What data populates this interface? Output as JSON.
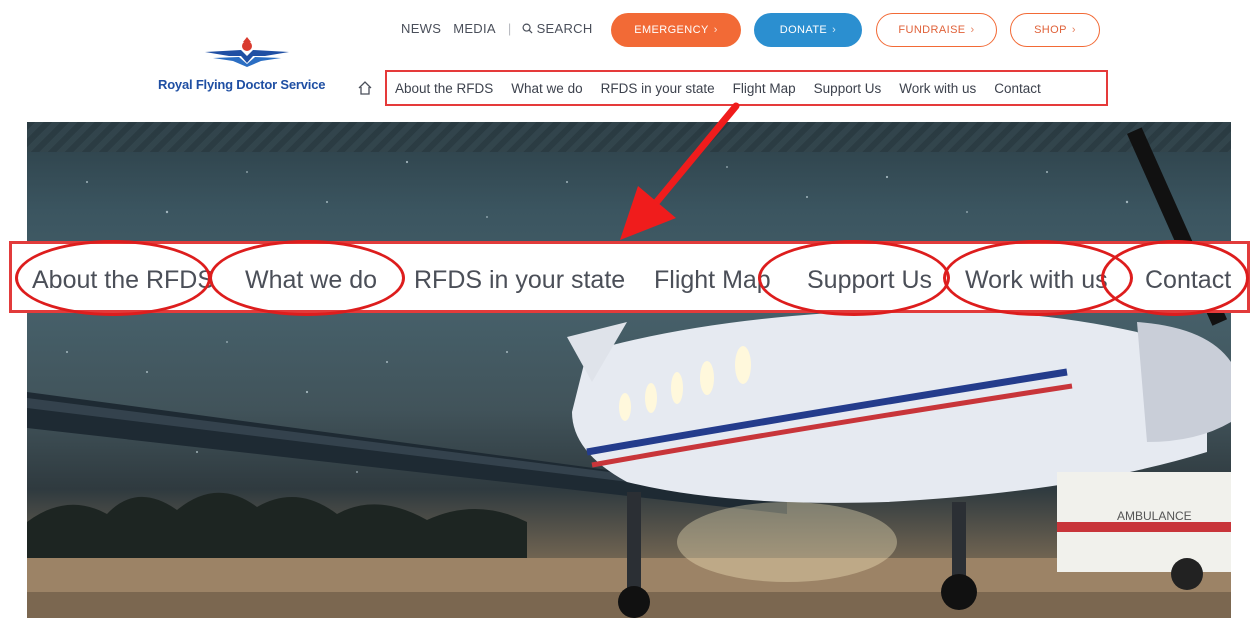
{
  "brand": {
    "name": "Royal Flying Doctor Service"
  },
  "utility": {
    "news": "NEWS",
    "media": "MEDIA",
    "separator": "|",
    "search": "SEARCH"
  },
  "buttons": {
    "emergency": "EMERGENCY",
    "donate": "DONATE",
    "fundraise": "FUNDRAISE",
    "shop": "SHOP",
    "chevron": "›"
  },
  "nav": {
    "items": [
      "About the RFDS",
      "What we do",
      "RFDS in your state",
      "Flight Map",
      "Support Us",
      "Work with us",
      "Contact"
    ]
  },
  "zoom": {
    "items": [
      "About the RFDS",
      "What we do",
      "RFDS in your state",
      "Flight Map",
      "Support Us",
      "Work with us",
      "Contact"
    ],
    "highlighted": [
      "About the RFDS",
      "What we do",
      "Support Us",
      "Work with us",
      "Contact"
    ]
  },
  "hero": {
    "vehicle_label": "AMBULANCE"
  },
  "colors": {
    "emergency": "#f26a36",
    "donate": "#2b8fd0",
    "brand_blue": "#1f4fa3",
    "annotation_red": "#e23b3b"
  },
  "icons": {
    "home": "home-icon",
    "search": "search-icon",
    "logo": "rfds-wings-logo"
  }
}
